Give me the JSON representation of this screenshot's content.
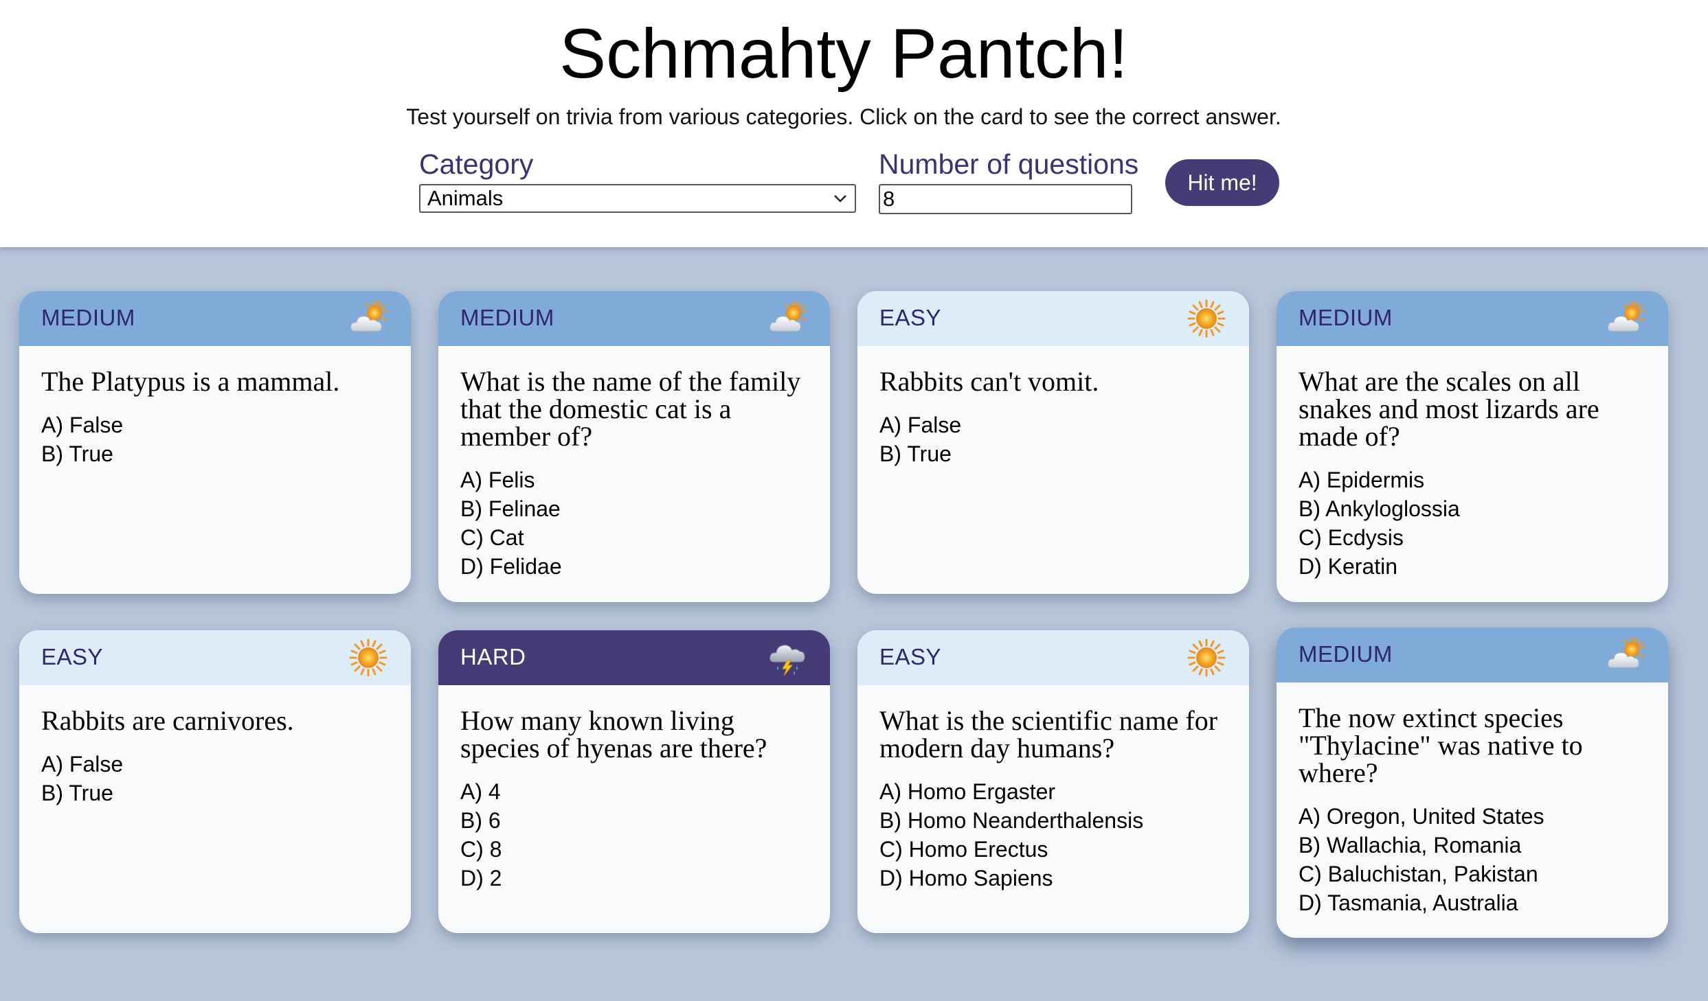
{
  "app": {
    "title": "Schmahty Pantch!",
    "subtitle": "Test yourself on trivia from various categories. Click on the card to see the correct answer."
  },
  "controls": {
    "category_label": "Category",
    "category_value": "Animals",
    "count_label": "Number of questions",
    "count_value": "8",
    "submit_label": "Hit me!"
  },
  "colors": {
    "brand": "#463b76",
    "medium_header": "#80aad8",
    "easy_header": "#deebf8",
    "hard_header": "#463b76",
    "background": "#b7c5d9"
  },
  "cards": [
    {
      "difficulty": "MEDIUM",
      "icon": "sun-behind-cloud-icon",
      "question": "The Platypus is a mammal.",
      "answers": [
        "A) False",
        "B) True"
      ]
    },
    {
      "difficulty": "MEDIUM",
      "icon": "sun-behind-cloud-icon",
      "question": "What is the name of the family that the domestic cat is a member of?",
      "answers": [
        "A) Felis",
        "B) Felinae",
        "C) Cat",
        "D) Felidae"
      ]
    },
    {
      "difficulty": "EASY",
      "icon": "sun-icon",
      "question": "Rabbits can't vomit.",
      "answers": [
        "A) False",
        "B) True"
      ]
    },
    {
      "difficulty": "MEDIUM",
      "icon": "sun-behind-cloud-icon",
      "question": "What are the scales on all snakes and most lizards are made of?",
      "answers": [
        "A) Epidermis",
        "B) Ankyloglossia",
        "C) Ecdysis",
        "D) Keratin"
      ]
    },
    {
      "difficulty": "EASY",
      "icon": "sun-icon",
      "question": "Rabbits are carnivores.",
      "answers": [
        "A) False",
        "B) True"
      ]
    },
    {
      "difficulty": "HARD",
      "icon": "storm-cloud-icon",
      "question": "How many known living species of hyenas are there?",
      "answers": [
        "A) 4",
        "B) 6",
        "C) 8",
        "D) 2"
      ]
    },
    {
      "difficulty": "EASY",
      "icon": "sun-icon",
      "question": "What is the scientific name for modern day humans?",
      "answers": [
        "A) Homo Ergaster",
        "B) Homo Neanderthalensis",
        "C) Homo Erectus",
        "D) Homo Sapiens"
      ]
    },
    {
      "difficulty": "MEDIUM",
      "icon": "sun-behind-cloud-icon",
      "question": "The now extinct species \"Thylacine\" was native to where?",
      "answers": [
        "A) Oregon, United States",
        "B) Wallachia, Romania",
        "C) Baluchistan, Pakistan",
        "D) Tasmania, Australia"
      ]
    }
  ]
}
